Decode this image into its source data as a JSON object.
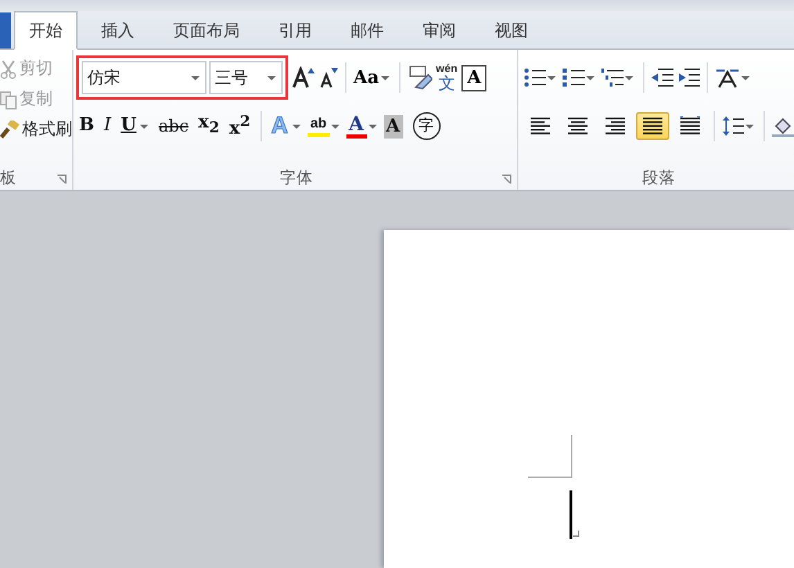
{
  "tabs": [
    {
      "label": "开始",
      "selected": true
    },
    {
      "label": "插入",
      "selected": false
    },
    {
      "label": "页面布局",
      "selected": false
    },
    {
      "label": "引用",
      "selected": false
    },
    {
      "label": "邮件",
      "selected": false
    },
    {
      "label": "审阅",
      "selected": false
    },
    {
      "label": "视图",
      "selected": false
    }
  ],
  "clipboard": {
    "items": [
      {
        "kind": "cut",
        "label": "剪切",
        "disabled": true
      },
      {
        "kind": "copy",
        "label": "复制",
        "disabled": true
      },
      {
        "kind": "painter",
        "label": "格式刷",
        "disabled": false
      }
    ],
    "group_label": "板"
  },
  "font": {
    "name": "仿宋",
    "size": "三号",
    "highlighted": true,
    "group_label": "字体",
    "case_button": "Aa",
    "phonetic": {
      "top": "wén",
      "bottom": "文"
    },
    "border_button": "A",
    "style_buttons": [
      {
        "kind": "bold",
        "label": "B"
      },
      {
        "kind": "italic",
        "label": "I"
      },
      {
        "kind": "underline",
        "label": "U"
      },
      {
        "kind": "strike",
        "label": "abc"
      },
      {
        "kind": "sub",
        "label": "x$_{2}$"
      },
      {
        "kind": "sup",
        "label": "x$^{2}$"
      }
    ],
    "effect_buttons": [
      {
        "kind": "effects",
        "label": "A"
      },
      {
        "kind": "highlight",
        "label": "ab"
      },
      {
        "kind": "color",
        "label": "A"
      },
      {
        "kind": "shade",
        "label": "A"
      },
      {
        "kind": "enclose",
        "label": "字"
      }
    ]
  },
  "paragraph": {
    "group_label": "段落",
    "alignments": [
      {
        "kind": "left",
        "selected": false
      },
      {
        "kind": "center",
        "selected": false
      },
      {
        "kind": "right",
        "selected": false
      },
      {
        "kind": "justify",
        "selected": true
      },
      {
        "kind": "distributed",
        "selected": false
      }
    ]
  }
}
